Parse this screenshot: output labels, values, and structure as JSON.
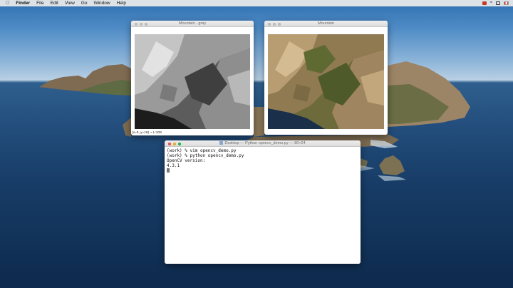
{
  "menubar": {
    "app": "Finder",
    "items": [
      "File",
      "Edit",
      "View",
      "Go",
      "Window",
      "Help"
    ]
  },
  "windows": {
    "gray": {
      "title": "Mountain - gray",
      "status": "(x=0, y=18) ~ L:108"
    },
    "color": {
      "title": "Mountain"
    },
    "terminal": {
      "title": "Desktop — Python opencv_demo.py — 80×24",
      "lines": [
        "(work) % vim opencv_demo.py",
        "(work) % python opencv_demo.py",
        "OpenCV version:",
        "4.3.1"
      ]
    }
  },
  "colors": {
    "close": "#fc5f57",
    "minimize": "#fdbb2e",
    "zoom": "#28c840",
    "sea": "#173c66"
  },
  "icons": [
    "apple-icon",
    "screen-record-icon",
    "wifi-icon",
    "airplay-icon",
    "flag-icon"
  ]
}
